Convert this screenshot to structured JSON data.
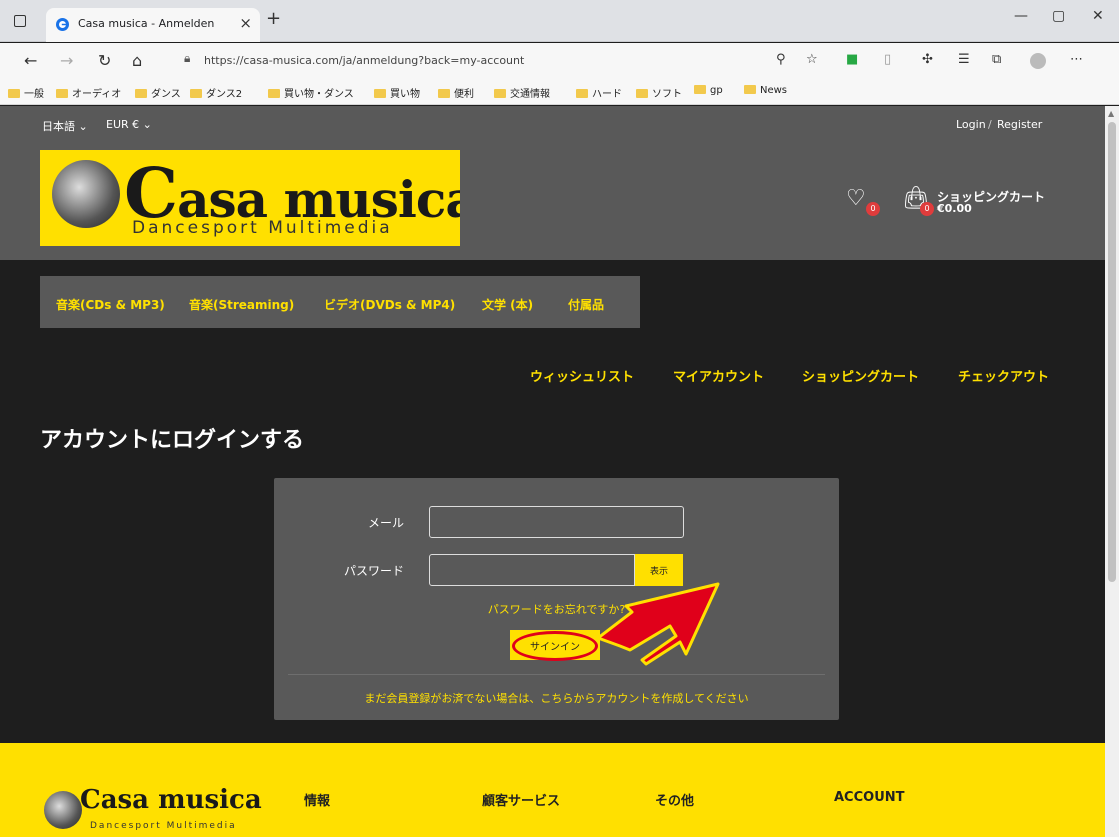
{
  "browser": {
    "tab_title": "Casa musica - Anmelden",
    "url": "https://casa-musica.com/ja/anmeldung?back=my-account",
    "bookmarks": [
      "一般",
      "オーディオ",
      "ダンス",
      "ダンス2",
      "買い物・ダンス",
      "買い物",
      "便利",
      "交通情報",
      "ハード",
      "ソフト",
      "gp",
      "News"
    ]
  },
  "topbar": {
    "language": "日本語",
    "currency": "EUR €",
    "login": "Login",
    "separator": "/",
    "register": "Register"
  },
  "header": {
    "brand_initial": "C",
    "brand_rest": "asa musica",
    "brand_sub": "Dancesport Multimedia",
    "wishlist_count": "0",
    "cart_count": "0",
    "cart_label": "ショッピングカート",
    "cart_total": "€0.00"
  },
  "categories": [
    "音楽(CDs & MP3)",
    "音楽(Streaming)",
    "ビデオ(DVDs & MP4)",
    "文学 (本)",
    "付属品"
  ],
  "account_links": [
    "ウィッシュリスト",
    "マイアカウント",
    "ショッピングカート",
    "チェックアウト"
  ],
  "login": {
    "title": "アカウントにログインする",
    "email_label": "メール",
    "email_value": "",
    "password_label": "パスワード",
    "password_value": "",
    "show_label": "表示",
    "forgot_label": "パスワードをお忘れですか?",
    "signin_label": "サインイン",
    "register_label": "まだ会員登録がお済でない場合は、こちらからアカウントを作成してください"
  },
  "footer": {
    "brand": "Casa musica",
    "brand_sub": "Dancesport Multimedia",
    "columns": [
      "情報",
      "顧客サービス",
      "その他",
      "ACCOUNT"
    ]
  },
  "colors": {
    "accent": "#ffe000",
    "panel": "#595959",
    "background": "#1e1e1e",
    "annotation": "#e0001a"
  }
}
